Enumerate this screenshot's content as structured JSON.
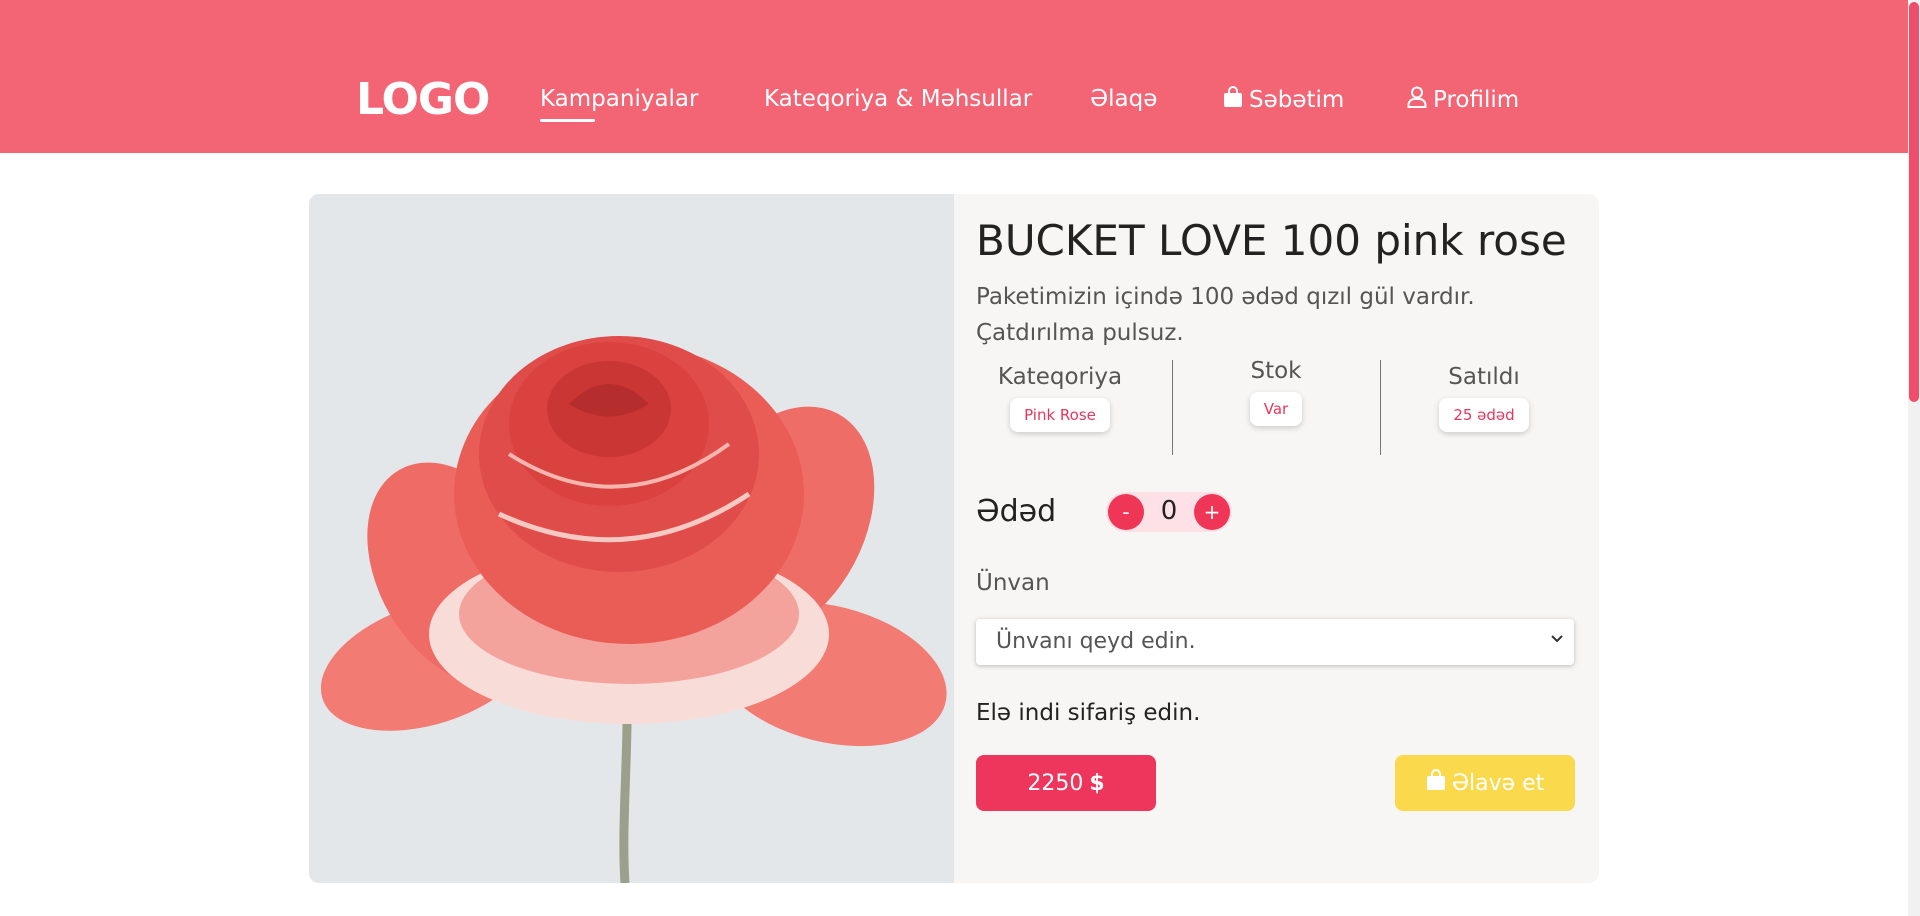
{
  "header": {
    "logo": "LOGO",
    "nav": [
      {
        "label": "Kampaniyalar",
        "icon": ""
      },
      {
        "label": "Kateqoriya & Məhsullar",
        "icon": ""
      },
      {
        "label": "Əlaqə",
        "icon": ""
      },
      {
        "label": "Səbətim",
        "icon": "shopping-bag-icon"
      },
      {
        "label": "Profilim",
        "icon": "user-icon"
      }
    ],
    "active_nav": "Kampaniyalar"
  },
  "product": {
    "title": "BUCKET LOVE 100 pink rose",
    "description": "Paketimizin içində 100 ədəd qızıl gül vardır. Çatdırılma pulsuz.",
    "image": "pink-rose-photo",
    "stats": [
      {
        "label": "Kateqoriya",
        "value": "Pink Rose"
      },
      {
        "label": "Stok",
        "value": "Var"
      },
      {
        "label": "Satıldı",
        "value": "25 ədəd"
      }
    ],
    "quantity": {
      "label": "Ədəd",
      "minus": "-",
      "value": "0",
      "plus": "+"
    },
    "address": {
      "label": "Ünvan",
      "selected": "Ünvanı qeyd edin."
    },
    "order_text": "Elə indi sifariş edin.",
    "price": {
      "amount": "2250",
      "currency_symbol": "$"
    },
    "add_button": "Əlavə et"
  },
  "colors": {
    "header": "#f36574",
    "accent": "#ee355b",
    "add_button": "#fbd94c",
    "badge_text": "#e8365a"
  }
}
